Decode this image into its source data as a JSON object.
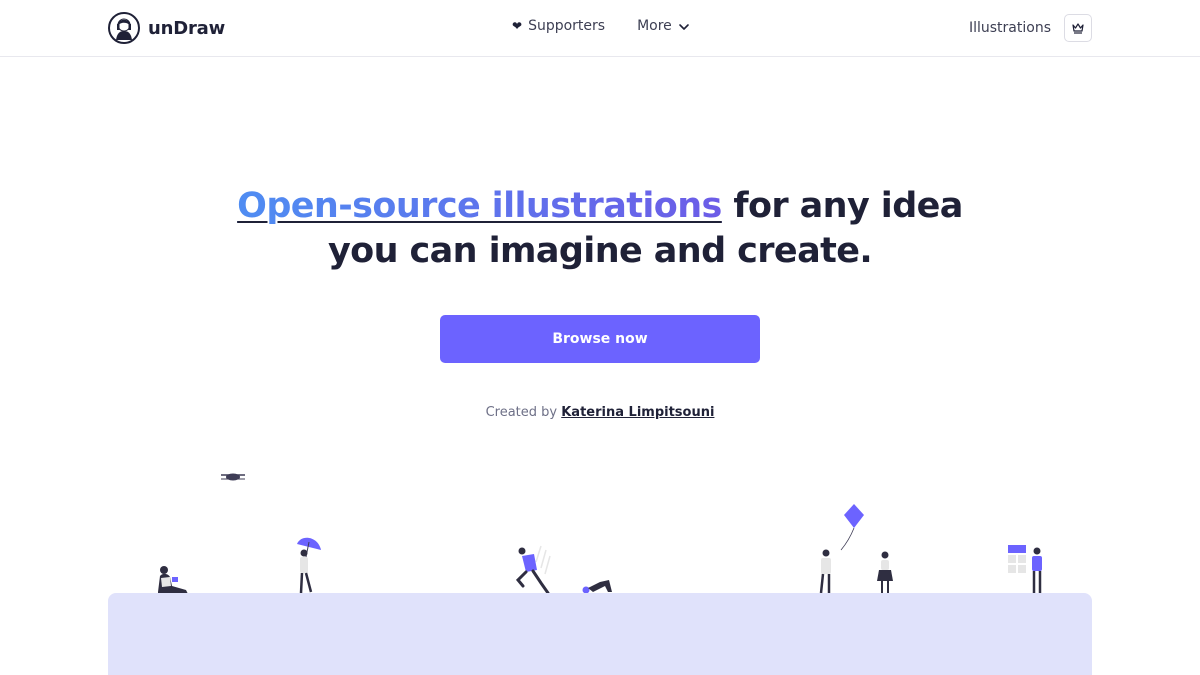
{
  "header": {
    "logo_text": "unDraw",
    "nav": {
      "supporters_icon": "heart-icon",
      "supporters_label": "Supporters",
      "more_label": "More",
      "illustrations_label": "Illustrations",
      "crown_icon": "crown-icon"
    }
  },
  "hero": {
    "title_accent": "Open-source illustrations",
    "title_rest_line1": " for any idea",
    "title_line2": "you can imagine and create.",
    "cta_label": "Browse now",
    "credit_prefix": "Created by ",
    "credit_author": "Katerina Limpitsouni"
  },
  "colors": {
    "accent": "#6c63ff",
    "ground": "#e0e2fb",
    "text": "#1f2137"
  }
}
